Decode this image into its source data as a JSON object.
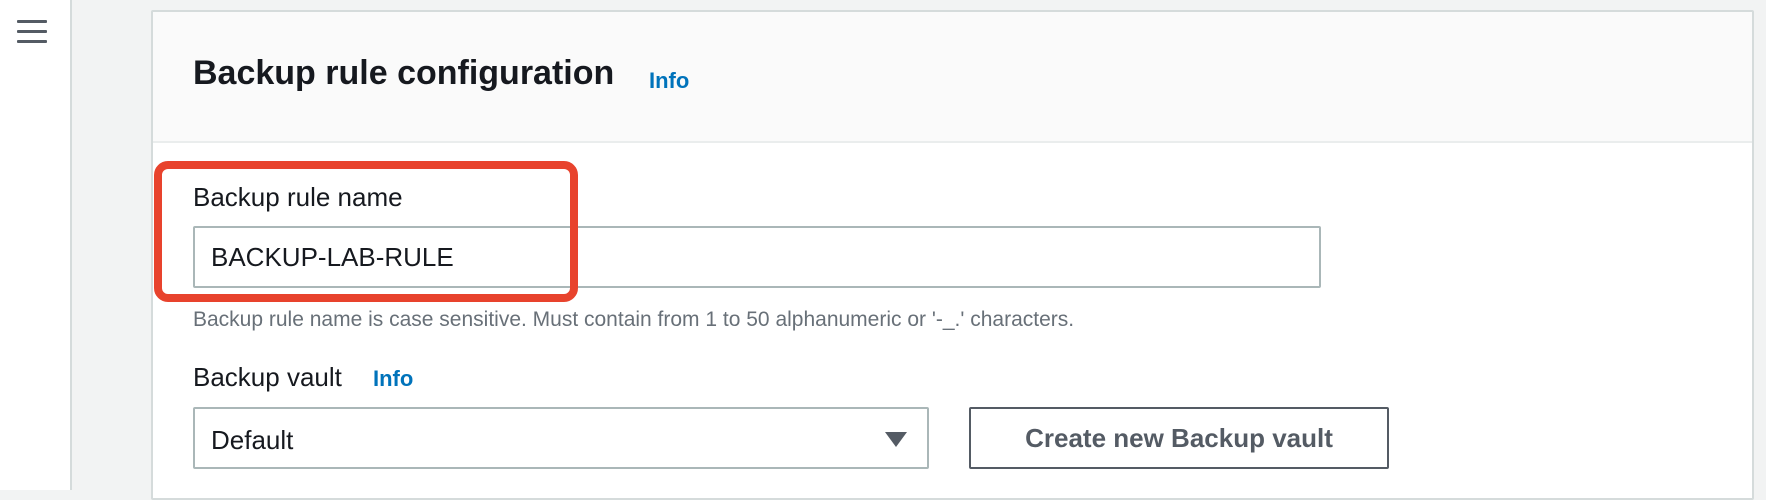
{
  "nav": {
    "menu_icon": "hamburger-menu-icon"
  },
  "panel": {
    "title": "Backup rule configuration",
    "info_label": "Info"
  },
  "rule_name": {
    "label": "Backup rule name",
    "value": "BACKUP-LAB-RULE",
    "helper": "Backup rule name is case sensitive. Must contain from 1 to 50 alphanumeric or '-_.' characters."
  },
  "vault": {
    "label": "Backup vault",
    "info_label": "Info",
    "selected": "Default",
    "dropdown_icon": "caret-down-icon",
    "create_button_label": "Create new Backup vault"
  },
  "colors": {
    "info_link": "#0073bb",
    "highlight": "#e8432d",
    "helper_text": "#687078"
  }
}
